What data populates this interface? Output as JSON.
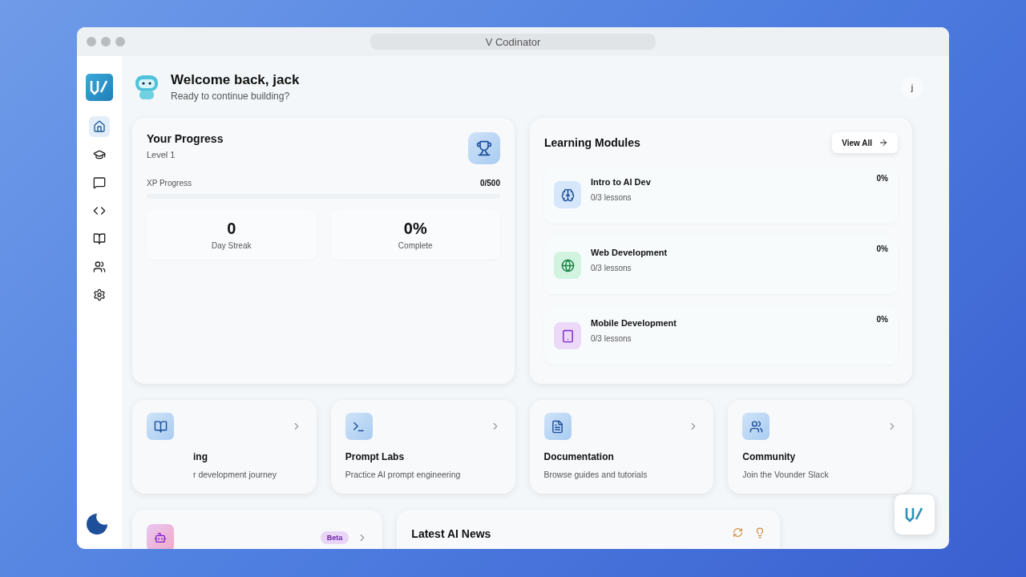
{
  "window": {
    "title": "V Codinator"
  },
  "sidebar": {
    "items": [
      {
        "selected": true
      },
      {
        "selected": false
      },
      {
        "selected": false
      },
      {
        "selected": false
      },
      {
        "selected": false
      },
      {
        "selected": false
      },
      {
        "selected": false
      }
    ]
  },
  "header": {
    "title": "Welcome back, jack",
    "subtitle": "Ready to continue building?",
    "avatar": "j"
  },
  "progress": {
    "title": "Your Progress",
    "level_label": "Level 1",
    "xp_label": "XP Progress",
    "xp_value": "0/500",
    "stats": [
      {
        "value": "0",
        "label": "Day Streak"
      },
      {
        "value": "0%",
        "label": "Complete"
      }
    ]
  },
  "modules": {
    "title": "Learning Modules",
    "view_all": "View All",
    "items": [
      {
        "name": "Intro to AI Dev",
        "lessons": "0/3 lessons",
        "percent": "0%",
        "color": "#d6e6fb"
      },
      {
        "name": "Web Development",
        "lessons": "0/3 lessons",
        "percent": "0%",
        "color": "#d3f3e1"
      },
      {
        "name": "Mobile Development",
        "lessons": "0/3 lessons",
        "percent": "0%",
        "color": "#ecd9f7"
      }
    ]
  },
  "quick_links": [
    {
      "title": "ing",
      "description": "r development journey"
    },
    {
      "title": "Prompt Labs",
      "description": "Practice AI prompt engineering"
    },
    {
      "title": "Documentation",
      "description": "Browse guides and tutorials"
    },
    {
      "title": "Community",
      "description": "Join the Vounder Slack"
    }
  ],
  "assistant_card": {
    "badge": "Beta"
  },
  "news": {
    "title": "Latest AI News"
  }
}
